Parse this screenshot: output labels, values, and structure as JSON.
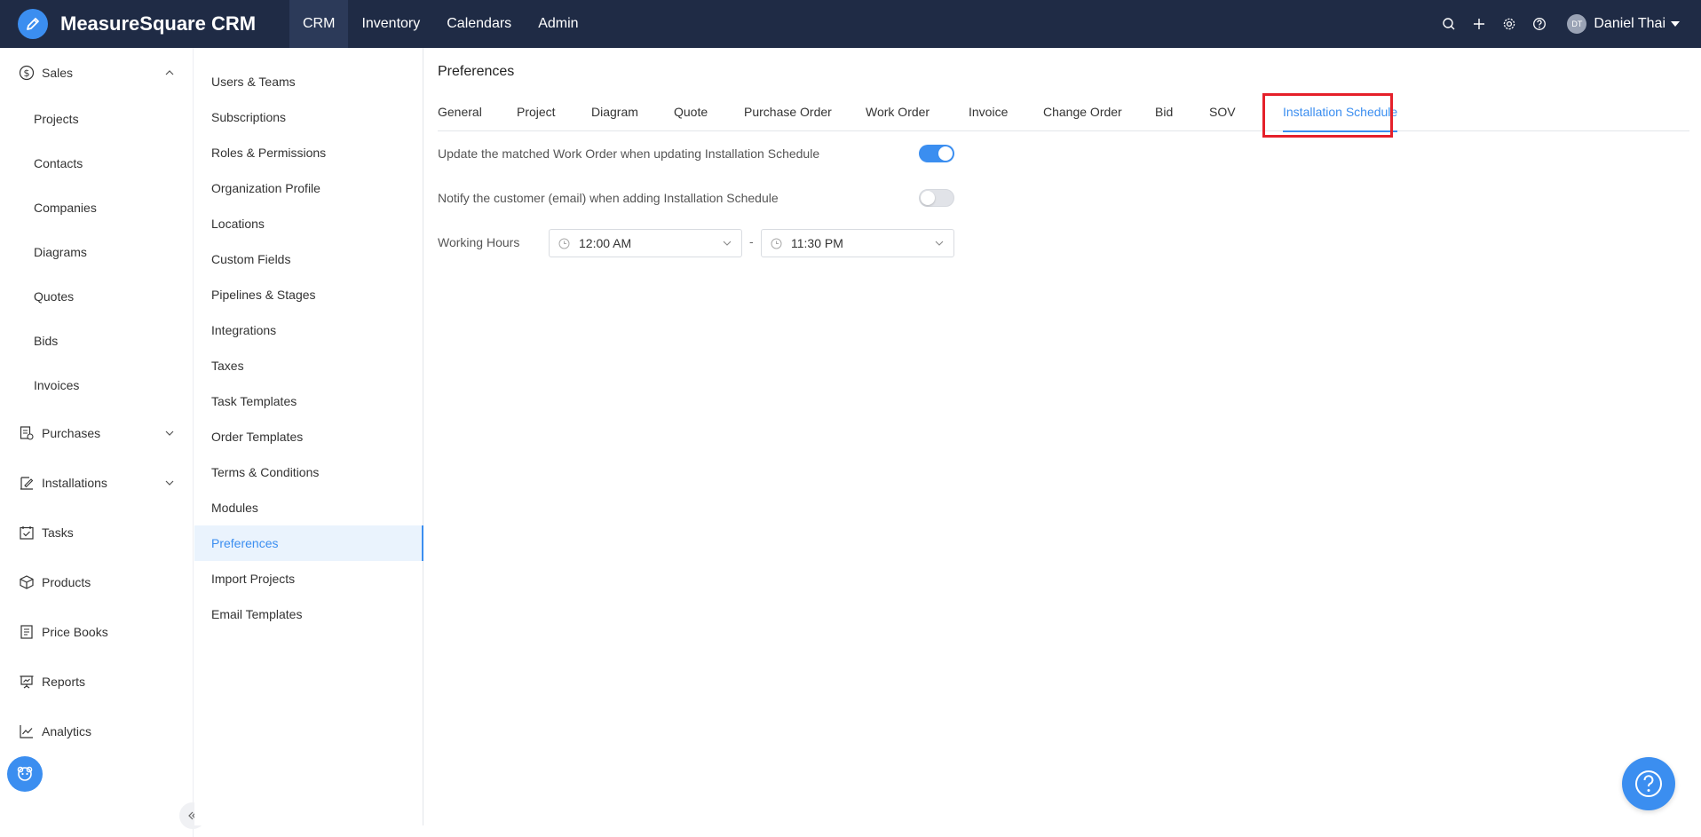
{
  "app": {
    "brand": "MeasureSquare CRM"
  },
  "topnav": {
    "items": [
      "CRM",
      "Inventory",
      "Calendars",
      "Admin"
    ],
    "active": "CRM"
  },
  "user": {
    "initials": "DT",
    "name": "Daniel Thai"
  },
  "icons": {
    "search": "search-icon",
    "add": "plus-icon",
    "settings": "gear-icon",
    "help": "question-icon"
  },
  "leftnav": {
    "sales": "Sales",
    "sales_items": [
      "Projects",
      "Contacts",
      "Companies",
      "Diagrams",
      "Quotes",
      "Bids",
      "Invoices"
    ],
    "purchases": "Purchases",
    "installations": "Installations",
    "tasks": "Tasks",
    "products": "Products",
    "price_books": "Price Books",
    "reports": "Reports",
    "analytics": "Analytics"
  },
  "settings_menu": {
    "items": [
      "Users & Teams",
      "Subscriptions",
      "Roles & Permissions",
      "Organization Profile",
      "Locations",
      "Custom Fields",
      "Pipelines & Stages",
      "Integrations",
      "Taxes",
      "Task Templates",
      "Order Templates",
      "Terms & Conditions",
      "Modules",
      "Preferences",
      "Import Projects",
      "Email Templates"
    ],
    "active": "Preferences"
  },
  "main": {
    "title": "Preferences",
    "tabs": [
      "General",
      "Project",
      "Diagram",
      "Quote",
      "Purchase Order",
      "Work Order",
      "Invoice",
      "Change Order",
      "Bid",
      "SOV",
      "Installation Schedule"
    ],
    "active_tab": "Installation Schedule",
    "pref1": {
      "label": "Update the matched Work Order when updating Installation Schedule",
      "enabled": true
    },
    "pref2": {
      "label": "Notify the customer (email) when adding Installation Schedule",
      "enabled": false
    },
    "working_hours": {
      "label": "Working Hours",
      "start": "12:00 AM",
      "separator": "-",
      "end": "11:30 PM"
    }
  },
  "colors": {
    "topbar": "#1f2b45",
    "accent": "#3b8ef0",
    "highlight": "#e5202a"
  }
}
